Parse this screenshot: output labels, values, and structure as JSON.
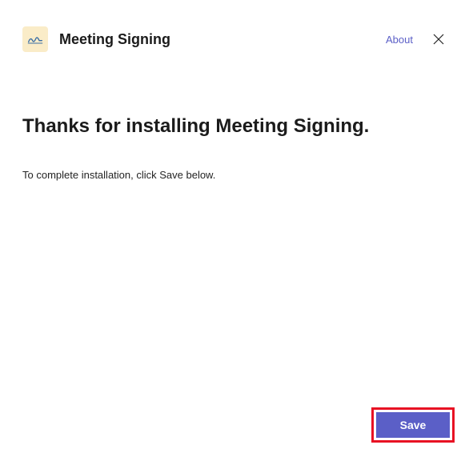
{
  "header": {
    "app_name": "Meeting Signing",
    "about_label": "About"
  },
  "content": {
    "heading": "Thanks for installing Meeting Signing.",
    "subtext": "To complete installation, click Save below."
  },
  "footer": {
    "save_label": "Save"
  }
}
